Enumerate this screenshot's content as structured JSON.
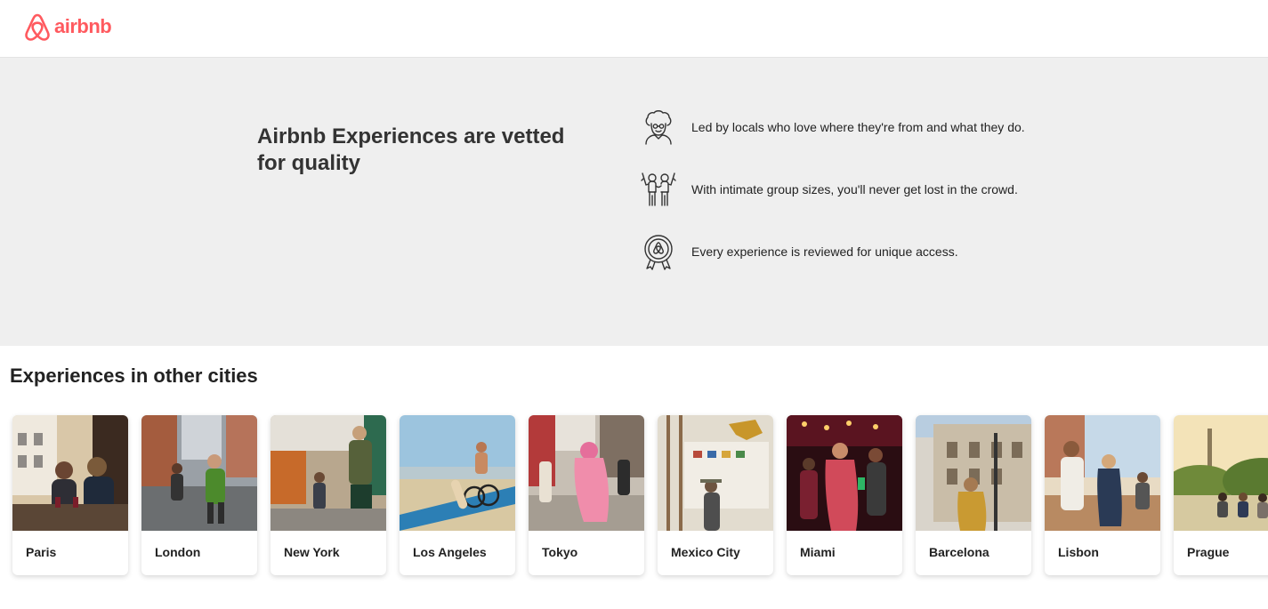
{
  "header": {
    "logo_text": "airbnb",
    "logo_icon": "airbnb-belo-icon",
    "brand_color": "#FF5A5F"
  },
  "hero": {
    "title": "Airbnb Experiences are vetted for quality",
    "background": "#EFEFEF",
    "features": [
      {
        "icon": "local-host-icon",
        "text": "Led by locals who love where they're from and what they do."
      },
      {
        "icon": "small-group-icon",
        "text": "With intimate group sizes, you'll never get lost in the crowd."
      },
      {
        "icon": "reviewed-badge-icon",
        "text": "Every experience is reviewed for unique access."
      }
    ]
  },
  "cities_section": {
    "title": "Experiences in other cities",
    "cities": [
      {
        "name": "Paris"
      },
      {
        "name": "London"
      },
      {
        "name": "New York"
      },
      {
        "name": "Los Angeles"
      },
      {
        "name": "Tokyo"
      },
      {
        "name": "Mexico City"
      },
      {
        "name": "Miami"
      },
      {
        "name": "Barcelona"
      },
      {
        "name": "Lisbon"
      },
      {
        "name": "Prague"
      }
    ]
  }
}
